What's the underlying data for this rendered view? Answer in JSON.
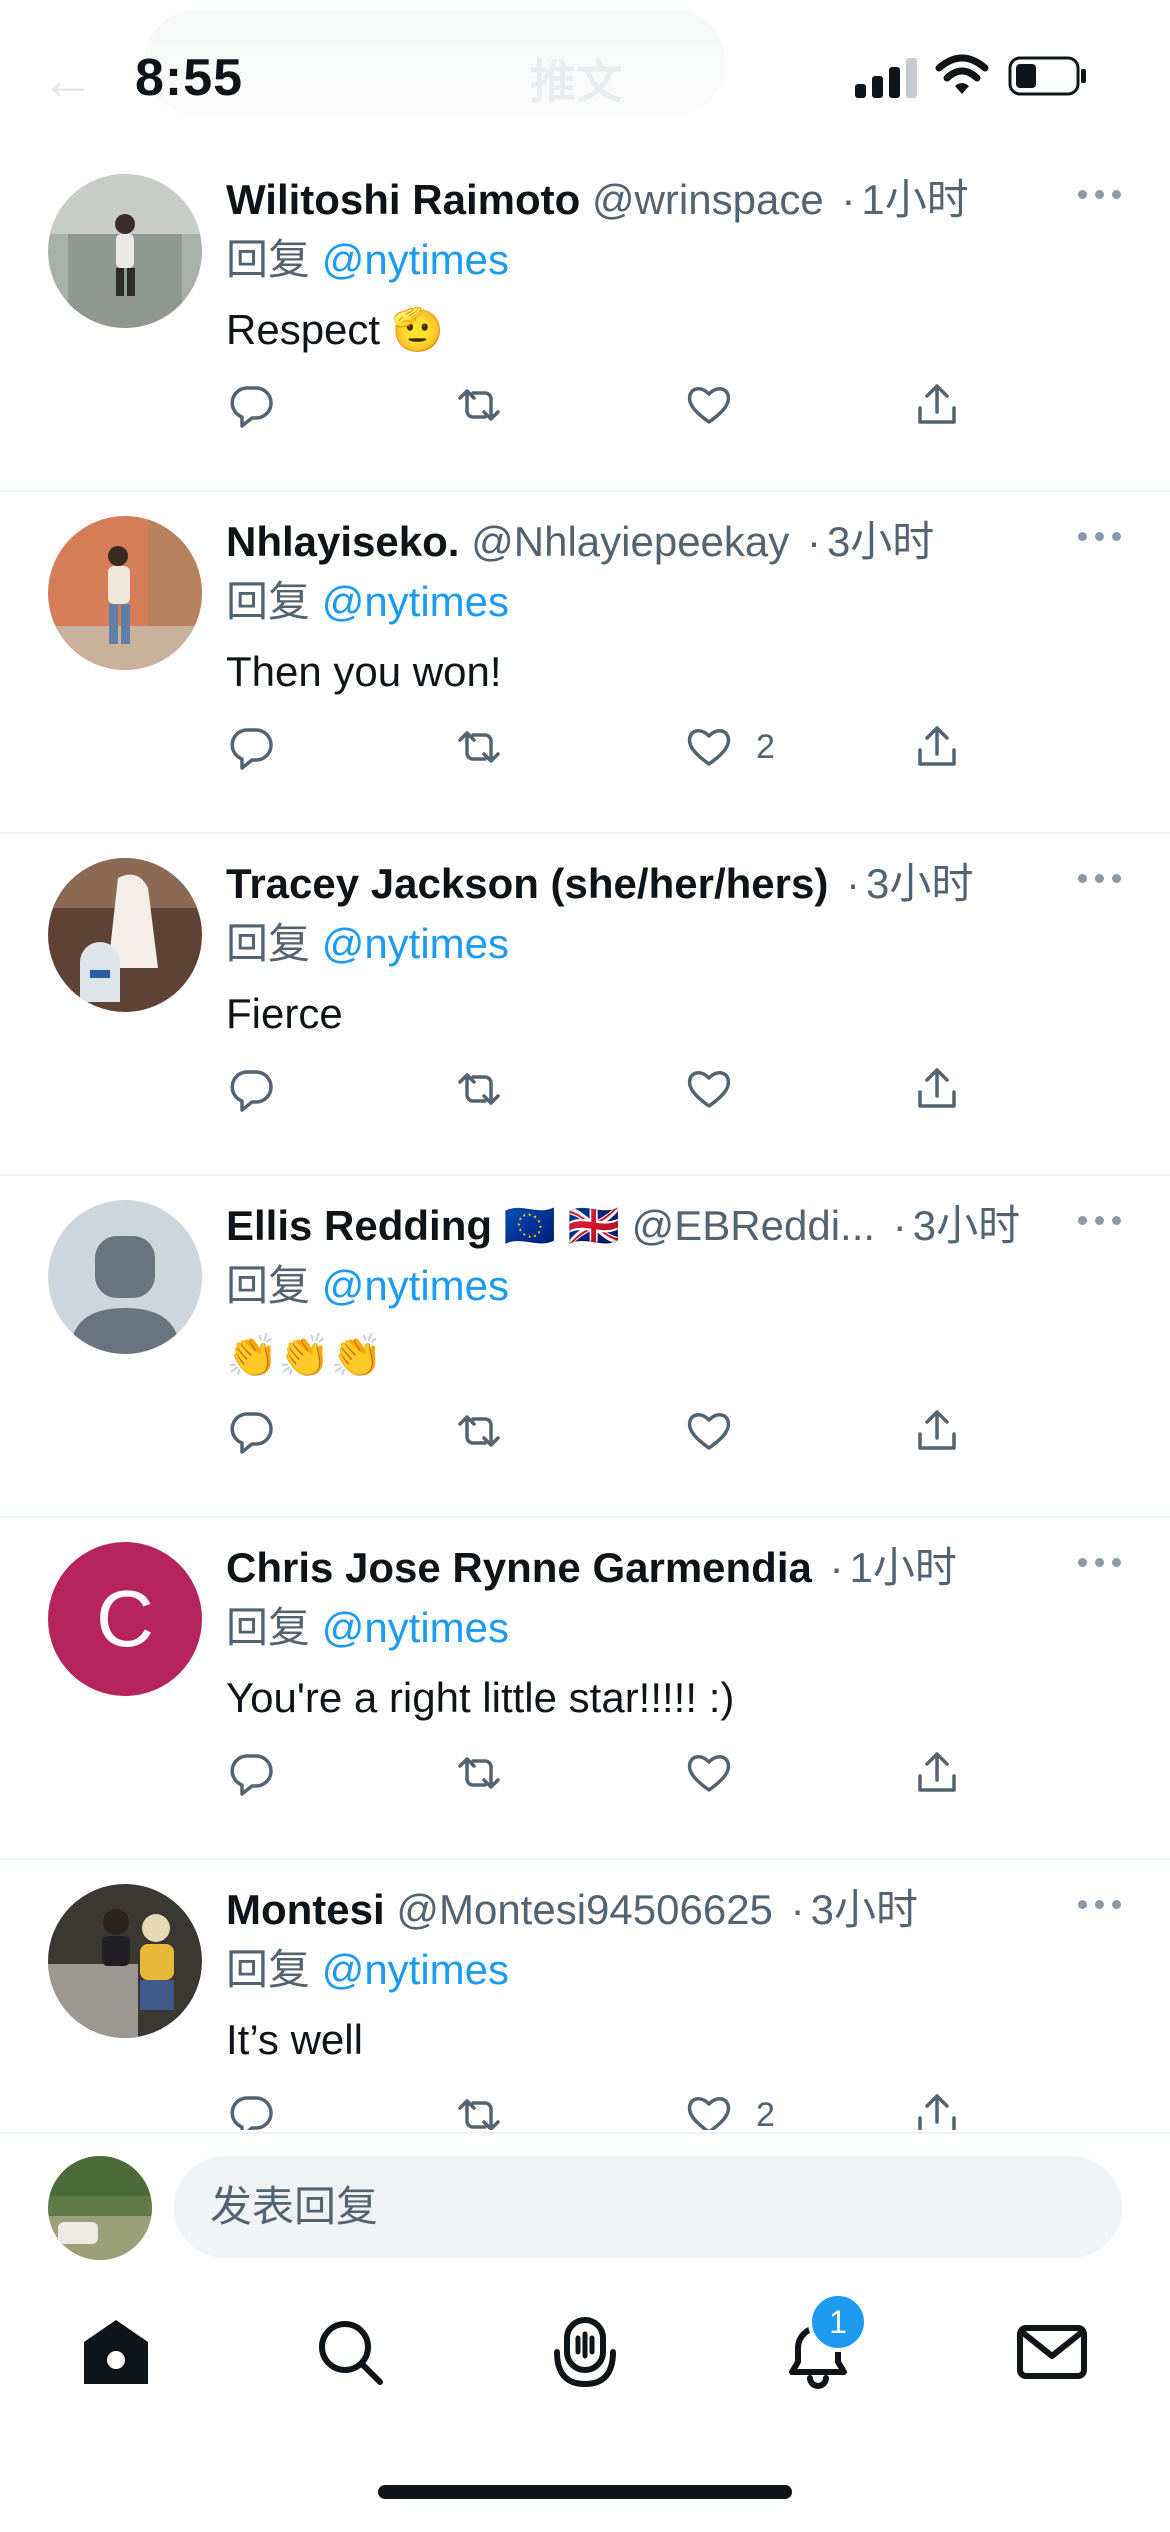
{
  "status_bar": {
    "time": "8:55"
  },
  "header": {
    "title": "推文",
    "back_icon": "arrow-left-icon"
  },
  "reply_prefix": "回复",
  "tweets": [
    {
      "name": "Wilitoshi Raimoto",
      "handle": "@wrinspace",
      "time": "1小时",
      "reply_to": "@nytimes",
      "text": "Respect 🫡",
      "likes": "",
      "avatar_color": "#9aa4a0"
    },
    {
      "name": "Nhlayiseko.",
      "handle": "@Nhlayiepeekay",
      "time": "3小时",
      "reply_to": "@nytimes",
      "text": "Then you won!",
      "likes": "2",
      "avatar_color": "#d88a66"
    },
    {
      "name": "Tracey Jackson (she/her/hers)",
      "handle": "",
      "time": "3小时",
      "reply_to": "@nytimes",
      "text": "Fierce",
      "likes": "",
      "avatar_color": "#6b4a3a"
    },
    {
      "name": "Ellis Redding 🇪🇺 🇬🇧",
      "handle": "@EBReddi...",
      "time": "3小时",
      "reply_to": "@nytimes",
      "text": "👏👏👏",
      "likes": "",
      "avatar_color": "#ccd6dd"
    },
    {
      "name": "Chris Jose Rynne Garmendia",
      "handle": "",
      "time": "1小时",
      "reply_to": "@nytimes",
      "text": "You're a right little star!!!!! :)",
      "likes": "",
      "avatar_color": "#b5245c",
      "avatar_letter": "C"
    },
    {
      "name": "Montesi",
      "handle": "@Montesi94506625",
      "time": "3小时",
      "reply_to": "@nytimes",
      "text": "It’s well",
      "likes": "2",
      "avatar_color": "#3d3a35"
    }
  ],
  "compose": {
    "placeholder": "发表回复"
  },
  "tabs": [
    {
      "name": "home",
      "icon": "home-icon"
    },
    {
      "name": "search",
      "icon": "search-icon"
    },
    {
      "name": "spaces",
      "icon": "spaces-icon"
    },
    {
      "name": "notifications",
      "icon": "bell-icon",
      "badge": "1"
    },
    {
      "name": "messages",
      "icon": "mail-icon"
    }
  ],
  "colors": {
    "accent": "#1d9bf0",
    "text": "#0f1419",
    "secondary": "#536471",
    "divider": "#eff3f4"
  }
}
